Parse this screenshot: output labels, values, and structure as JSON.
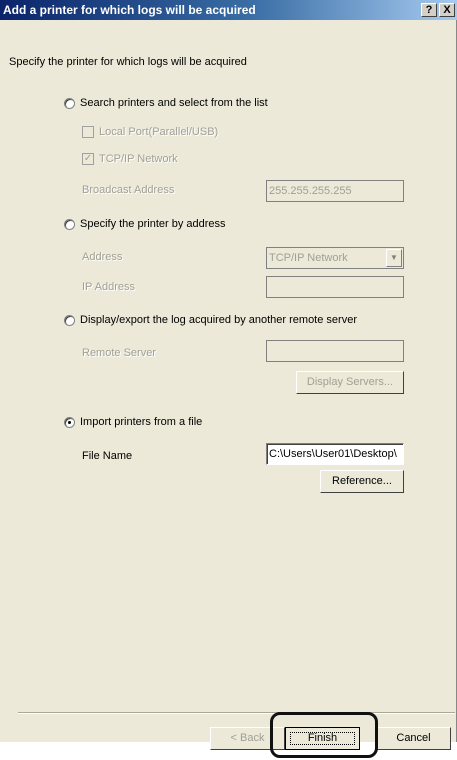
{
  "window": {
    "title": "Add a printer for which logs will be acquired",
    "help_label": "?",
    "close_label": "X"
  },
  "instruction": "Specify the printer for which logs will be acquired",
  "search_section": {
    "radio_label": "Search printers and select from the list",
    "selected": false,
    "local_port_label": "Local Port(Parallel/USB)",
    "local_port_checked": false,
    "tcpip_label": "TCP/IP Network",
    "tcpip_checked": true,
    "broadcast_label": "Broadcast Address",
    "broadcast_value": "255.255.255.255"
  },
  "address_section": {
    "radio_label": "Specify the printer by address",
    "selected": false,
    "address_label": "Address",
    "address_value": "TCP/IP Network",
    "ip_label": "IP Address",
    "ip_value": ""
  },
  "remote_section": {
    "radio_label": "Display/export the log acquired by another remote server",
    "selected": false,
    "server_label": "Remote Server",
    "server_value": "",
    "display_servers_label": "Display Servers..."
  },
  "import_section": {
    "radio_label": "Import printers from a file",
    "selected": true,
    "file_label": "File Name",
    "file_value": "C:\\Users\\User01\\Desktop\\",
    "reference_label": "Reference..."
  },
  "footer": {
    "back_label": "< Back",
    "finish_label": "Finish",
    "cancel_label": "Cancel"
  }
}
